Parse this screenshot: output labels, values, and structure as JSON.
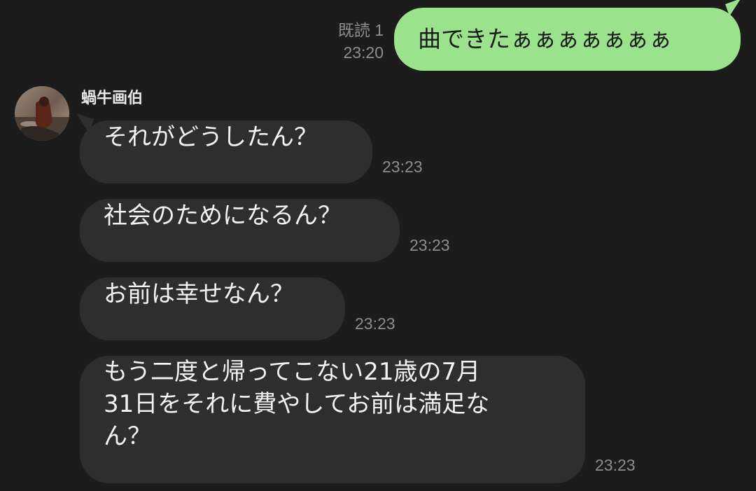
{
  "sent": {
    "read_label": "既読 1",
    "time": "23:20",
    "text": "曲できたぁぁぁぁぁぁぁ",
    "bubble_color": "#9be28c"
  },
  "received": {
    "sender_name": "蝸牛画伯",
    "avatar_icon": "user-avatar-photo",
    "bubble_color": "#2e2e2e",
    "messages": [
      {
        "lines": [
          "それがどうしたん？"
        ],
        "time": "23:23"
      },
      {
        "lines": [
          "社会のためになるん？"
        ],
        "time": "23:23"
      },
      {
        "lines": [
          "お前は幸せなん？"
        ],
        "time": "23:23"
      },
      {
        "lines": [
          "もう二度と帰ってこない21歳の7月",
          "31日をそれに費やしてお前は満足な",
          "ん？"
        ],
        "time": "23:23"
      }
    ]
  },
  "theme": {
    "background": "#1c1c1c",
    "timestamp_color": "#8d8d8d"
  }
}
